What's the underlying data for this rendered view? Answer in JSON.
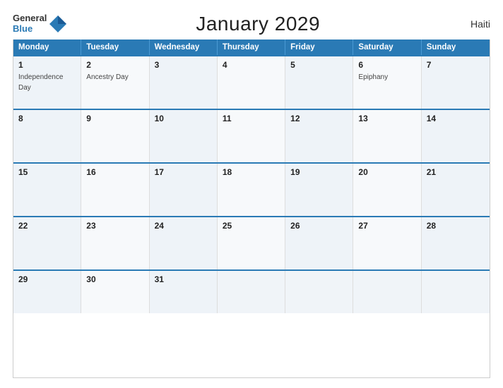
{
  "header": {
    "logo_general": "General",
    "logo_blue": "Blue",
    "title": "January 2029",
    "country": "Haiti"
  },
  "calendar": {
    "days_of_week": [
      "Monday",
      "Tuesday",
      "Wednesday",
      "Thursday",
      "Friday",
      "Saturday",
      "Sunday"
    ],
    "weeks": [
      [
        {
          "day": "1",
          "event": "Independence Day"
        },
        {
          "day": "2",
          "event": "Ancestry Day"
        },
        {
          "day": "3",
          "event": ""
        },
        {
          "day": "4",
          "event": ""
        },
        {
          "day": "5",
          "event": ""
        },
        {
          "day": "6",
          "event": "Epiphany"
        },
        {
          "day": "7",
          "event": ""
        }
      ],
      [
        {
          "day": "8",
          "event": ""
        },
        {
          "day": "9",
          "event": ""
        },
        {
          "day": "10",
          "event": ""
        },
        {
          "day": "11",
          "event": ""
        },
        {
          "day": "12",
          "event": ""
        },
        {
          "day": "13",
          "event": ""
        },
        {
          "day": "14",
          "event": ""
        }
      ],
      [
        {
          "day": "15",
          "event": ""
        },
        {
          "day": "16",
          "event": ""
        },
        {
          "day": "17",
          "event": ""
        },
        {
          "day": "18",
          "event": ""
        },
        {
          "day": "19",
          "event": ""
        },
        {
          "day": "20",
          "event": ""
        },
        {
          "day": "21",
          "event": ""
        }
      ],
      [
        {
          "day": "22",
          "event": ""
        },
        {
          "day": "23",
          "event": ""
        },
        {
          "day": "24",
          "event": ""
        },
        {
          "day": "25",
          "event": ""
        },
        {
          "day": "26",
          "event": ""
        },
        {
          "day": "27",
          "event": ""
        },
        {
          "day": "28",
          "event": ""
        }
      ],
      [
        {
          "day": "29",
          "event": ""
        },
        {
          "day": "30",
          "event": ""
        },
        {
          "day": "31",
          "event": ""
        },
        {
          "day": "",
          "event": ""
        },
        {
          "day": "",
          "event": ""
        },
        {
          "day": "",
          "event": ""
        },
        {
          "day": "",
          "event": ""
        }
      ]
    ]
  }
}
